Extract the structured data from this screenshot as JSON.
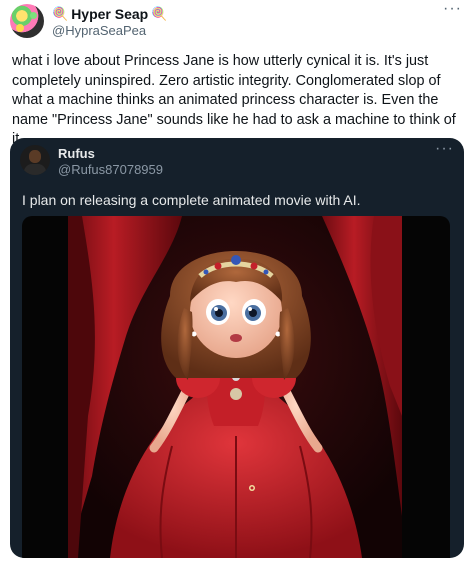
{
  "tweet": {
    "display_name": "Hyper Seap",
    "name_emoji": "🍭",
    "handle": "@HypraSeaPea",
    "more_label": "···",
    "text": "what i love about Princess Jane is how utterly cynical it is. It's just completely uninspired. Zero artistic integrity. Conglomerated slop of what a machine thinks an animated princess character is. Even the name \"Princess Jane\" sounds like he had to ask a machine to think of it"
  },
  "quote": {
    "display_name": "Rufus",
    "handle": "@Rufus87078959",
    "more_label": "···",
    "text": "I plan on releasing a complete animated movie with AI."
  },
  "colors": {
    "quote_background": "#15202b",
    "dress_red": "#c8202a",
    "curtain_red": "#a8151d"
  }
}
